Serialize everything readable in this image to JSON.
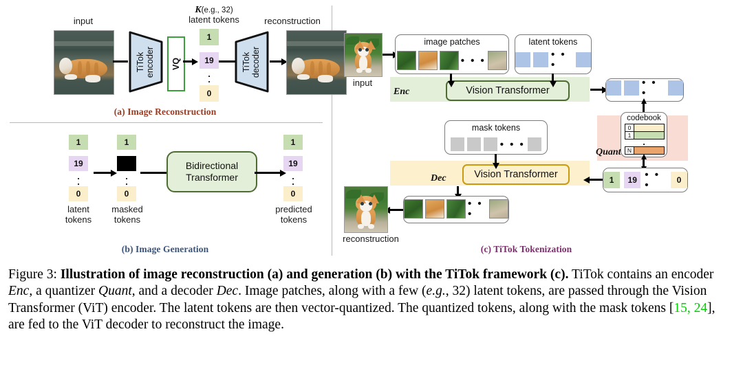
{
  "figure": {
    "panels": {
      "a": {
        "caption": "(a) Image Reconstruction",
        "caption_color": "#9a3b22",
        "input_label": "input",
        "output_label": "reconstruction",
        "encoder_line1": "TiTok",
        "encoder_line2": "encoder",
        "decoder_line1": "TiTok",
        "decoder_line2": "decoder",
        "vq_label": "VQ",
        "tokens_header_k": "K",
        "tokens_header_eg": "(e.g., 32)",
        "tokens_header_line2": "latent tokens",
        "token_values": [
          "1",
          "19",
          "0"
        ],
        "token_colors": {
          "green": "#c6ddb1",
          "purple": "#e7d6f2",
          "yellow": "#fbeeca"
        },
        "vertical_dots": ":"
      },
      "b": {
        "caption": "(b) Image Generation",
        "caption_color": "#3c5378",
        "transformer_line1": "Bidirectional",
        "transformer_line2": "Transformer",
        "transformer_fill": "#e3efd8",
        "transformer_border": "#4e6b33",
        "col1_label_line1": "latent",
        "col1_label_line2": "tokens",
        "col2_label_line1": "masked",
        "col2_label_line2": "tokens",
        "col3_label_line1": "predicted",
        "col3_label_line2": "tokens",
        "latent_tokens": [
          "1",
          "19",
          "0"
        ],
        "masked_tokens": [
          "1",
          "MASK",
          "0"
        ],
        "predicted_tokens": [
          "1",
          "19",
          "0"
        ]
      },
      "c": {
        "caption": "(c) TiTok Tokenization",
        "caption_color": "#7b2f6b",
        "input_label": "input",
        "output_label": "reconstruction",
        "image_patches_title": "image patches",
        "latent_tokens_title": "latent tokens",
        "mask_tokens_title": "mask tokens",
        "enc_name": "Enc",
        "dec_name": "Dec",
        "quant_name": "Quant",
        "vit_enc_label": "Vision Transformer",
        "vit_dec_label": "Vision Transformer",
        "codebook_title": "codebook",
        "codebook_rows": [
          {
            "index": "0",
            "color": "#fbeeca"
          },
          {
            "index": "1",
            "color": "#c6ddb1"
          },
          {
            "index": "N",
            "color": "#eaa36a"
          }
        ],
        "codebook_dots": ":",
        "quantized_tokens": [
          "1",
          "19",
          "0"
        ],
        "dots": "• • •",
        "band_colors": {
          "enc": "#e3efd8",
          "dec": "#fdf0cd",
          "quant": "#f9dcd4"
        },
        "token_blue": "#aec4e6",
        "token_gray": "#c9c9c9"
      }
    },
    "caption": {
      "label": "Figure 3:",
      "bold_part": "Illustration of image reconstruction (a) and generation (b) with the TiTok framework (c).",
      "rest_1": " TiTok contains an encoder ",
      "enc": "Enc",
      "rest_2": ", a quantizer ",
      "quant": "Quant",
      "rest_3": ", and a decoder ",
      "dec": "Dec",
      "rest_4": ". Image patches, along with a few (",
      "eg": "e.g.",
      "rest_5": ", 32) latent tokens, are passed through the Vision Transformer (ViT) encoder. The latent tokens are then vector-quantized. The quantized tokens, along with the mask tokens [",
      "ref1": "15",
      "ref_sep": ", ",
      "ref2": "24",
      "rest_6": "], are fed to the ViT decoder to reconstruct the image.",
      "ref_color": "#00d000"
    }
  }
}
